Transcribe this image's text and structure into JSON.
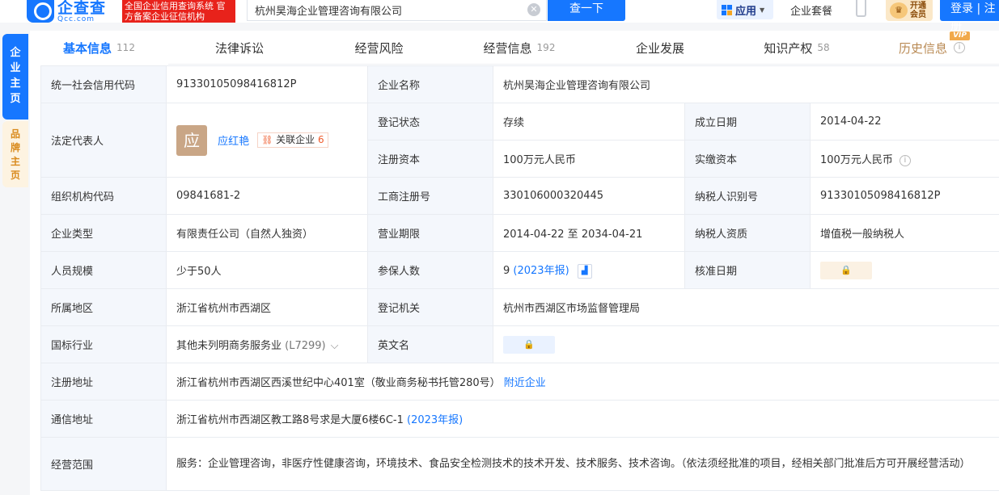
{
  "header": {
    "logo_cn": "企查查",
    "logo_en": "Qcc.com",
    "logo_badge": "全国企业信用查询系统 官方备案企业征信机构",
    "search_value": "杭州昊海企业管理咨询有限公司",
    "search_button": "查一下",
    "app_label": "应用",
    "suite_label": "企业套餐",
    "vip_label": "开通会员",
    "login_label": "登录 | 注册"
  },
  "side": {
    "company": [
      "企",
      "业",
      "主",
      "页"
    ],
    "brand": [
      "品",
      "牌",
      "主",
      "页"
    ]
  },
  "tabs": [
    {
      "label": "基本信息",
      "count": "112"
    },
    {
      "label": "法律诉讼",
      "count": ""
    },
    {
      "label": "经营风险",
      "count": ""
    },
    {
      "label": "经营信息",
      "count": "192"
    },
    {
      "label": "企业发展",
      "count": ""
    },
    {
      "label": "知识产权",
      "count": "58"
    },
    {
      "label": "历史信息",
      "count": "",
      "tag": "VIP"
    }
  ],
  "info": {
    "credit_code_label": "统一社会信用代码",
    "credit_code": "91330105098416812P",
    "name_label": "企业名称",
    "name": "杭州昊海企业管理咨询有限公司",
    "legal_rep_label": "法定代表人",
    "legal_rep_avatar": "应",
    "legal_rep_name": "应红艳",
    "related_label": "关联企业",
    "related_count": "6",
    "status_label": "登记状态",
    "status": "存续",
    "founded_label": "成立日期",
    "founded": "2014-04-22",
    "reg_capital_label": "注册资本",
    "reg_capital": "100万元人民币",
    "paid_capital_label": "实缴资本",
    "paid_capital": "100万元人民币",
    "org_code_label": "组织机构代码",
    "org_code": "09841681-2",
    "biz_reg_label": "工商注册号",
    "biz_reg": "330106000320445",
    "taxpayer_id_label": "纳税人识别号",
    "taxpayer_id": "91330105098416812P",
    "type_label": "企业类型",
    "type": "有限责任公司（自然人独资）",
    "term_label": "营业期限",
    "term": "2014-04-22 至 2034-04-21",
    "taxpayer_qual_label": "纳税人资质",
    "taxpayer_qual": "增值税一般纳税人",
    "staff_label": "人员规模",
    "staff": "少于50人",
    "insured_label": "参保人数",
    "insured": "9",
    "insured_year": "(2023年报)",
    "approval_label": "核准日期",
    "region_label": "所属地区",
    "region": "浙江省杭州市西湖区",
    "authority_label": "登记机关",
    "authority": "杭州市西湖区市场监督管理局",
    "industry_label": "国标行业",
    "industry": "其他未列明商务服务业",
    "industry_code": "(L7299)",
    "english_label": "英文名",
    "reg_address_label": "注册地址",
    "reg_address": "浙江省杭州市西湖区西溪世纪中心401室（敬业商务秘书托管280号）",
    "nearby_label": "附近企业",
    "mail_address_label": "通信地址",
    "mail_address": "浙江省杭州市西湖区教工路8号求是大厦6楼6C-1",
    "mail_year": "(2023年报)",
    "scope_label": "经营范围",
    "scope": "服务：企业管理咨询，非医疗性健康咨询，环境技术、食品安全检测技术的技术开发、技术服务、技术咨询。（依法须经批准的项目，经相关部门批准后方可开展经营活动）"
  }
}
